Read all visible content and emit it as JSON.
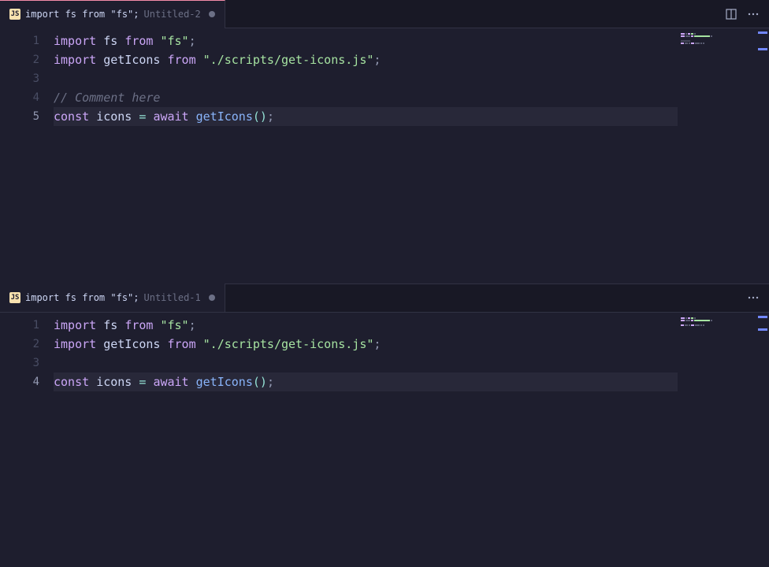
{
  "panes": [
    {
      "id": "top",
      "tab": {
        "lang_badge": "JS",
        "title": "import fs from \"fs\";",
        "subtitle": "Untitled-2",
        "dirty": true,
        "active_indicator": true
      },
      "actions": {
        "split": true,
        "more": true
      },
      "current_line": 5,
      "lines": [
        {
          "n": 1,
          "tokens": [
            {
              "t": "import",
              "c": "kw"
            },
            {
              "t": " ",
              "c": "var"
            },
            {
              "t": "fs",
              "c": "var"
            },
            {
              "t": " ",
              "c": "var"
            },
            {
              "t": "from",
              "c": "kw"
            },
            {
              "t": " ",
              "c": "var"
            },
            {
              "t": "\"fs\"",
              "c": "str"
            },
            {
              "t": ";",
              "c": "semi"
            }
          ]
        },
        {
          "n": 2,
          "tokens": [
            {
              "t": "import",
              "c": "kw"
            },
            {
              "t": " ",
              "c": "var"
            },
            {
              "t": "getIcons",
              "c": "var"
            },
            {
              "t": " ",
              "c": "var"
            },
            {
              "t": "from",
              "c": "kw"
            },
            {
              "t": " ",
              "c": "var"
            },
            {
              "t": "\"./scripts/get-icons.js\"",
              "c": "str"
            },
            {
              "t": ";",
              "c": "semi"
            }
          ]
        },
        {
          "n": 3,
          "tokens": []
        },
        {
          "n": 4,
          "tokens": [
            {
              "t": "// Comment here",
              "c": "comment"
            }
          ]
        },
        {
          "n": 5,
          "tokens": [
            {
              "t": "const",
              "c": "kw"
            },
            {
              "t": " ",
              "c": "var"
            },
            {
              "t": "icons",
              "c": "var"
            },
            {
              "t": " ",
              "c": "var"
            },
            {
              "t": "=",
              "c": "punc"
            },
            {
              "t": " ",
              "c": "var"
            },
            {
              "t": "await",
              "c": "kw"
            },
            {
              "t": " ",
              "c": "var"
            },
            {
              "t": "getIcons",
              "c": "fn"
            },
            {
              "t": "()",
              "c": "punc"
            },
            {
              "t": ";",
              "c": "semi"
            }
          ]
        }
      ]
    },
    {
      "id": "bottom",
      "tab": {
        "lang_badge": "JS",
        "title": "import fs from \"fs\";",
        "subtitle": "Untitled-1",
        "dirty": true,
        "active_indicator": false
      },
      "actions": {
        "split": false,
        "more": true
      },
      "current_line": 4,
      "lines": [
        {
          "n": 1,
          "tokens": [
            {
              "t": "import",
              "c": "kw"
            },
            {
              "t": " ",
              "c": "var"
            },
            {
              "t": "fs",
              "c": "var"
            },
            {
              "t": " ",
              "c": "var"
            },
            {
              "t": "from",
              "c": "kw"
            },
            {
              "t": " ",
              "c": "var"
            },
            {
              "t": "\"fs\"",
              "c": "str"
            },
            {
              "t": ";",
              "c": "semi"
            }
          ]
        },
        {
          "n": 2,
          "tokens": [
            {
              "t": "import",
              "c": "kw"
            },
            {
              "t": " ",
              "c": "var"
            },
            {
              "t": "getIcons",
              "c": "var"
            },
            {
              "t": " ",
              "c": "var"
            },
            {
              "t": "from",
              "c": "kw"
            },
            {
              "t": " ",
              "c": "var"
            },
            {
              "t": "\"./scripts/get-icons.js\"",
              "c": "str"
            },
            {
              "t": ";",
              "c": "semi"
            }
          ]
        },
        {
          "n": 3,
          "tokens": []
        },
        {
          "n": 4,
          "tokens": [
            {
              "t": "const",
              "c": "kw"
            },
            {
              "t": " ",
              "c": "var"
            },
            {
              "t": "icons",
              "c": "var"
            },
            {
              "t": " ",
              "c": "var"
            },
            {
              "t": "=",
              "c": "punc"
            },
            {
              "t": " ",
              "c": "var"
            },
            {
              "t": "await",
              "c": "kw"
            },
            {
              "t": " ",
              "c": "var"
            },
            {
              "t": "getIcons",
              "c": "fn"
            },
            {
              "t": "()",
              "c": "punc"
            },
            {
              "t": ";",
              "c": "semi"
            }
          ]
        }
      ]
    }
  ]
}
